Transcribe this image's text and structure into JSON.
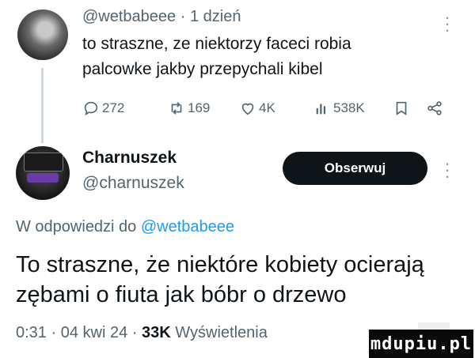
{
  "parent_tweet": {
    "handle": "@wetbabeee",
    "separator": "·",
    "time": "1 dzień",
    "text": "to straszne, ze niektorzy faceci robia palcowke jakby przepychali kibel",
    "actions": {
      "replies": "272",
      "retweets": "169",
      "likes": "4K",
      "views": "538K"
    }
  },
  "reply_tweet": {
    "display_name": "Charnuszek",
    "handle": "@charnuszek",
    "follow_label": "Obserwuj",
    "reply_to_prefix": "W odpowiedzi do",
    "reply_to_handle": "@wetbabeee",
    "text": "To straszne, że niektóre kobiety ocierają zębami o fiuta jak bóbr o drzewo",
    "time": "0:31",
    "separator": "·",
    "date": "04 kwi 24",
    "separator2": "·",
    "views_count": "33K",
    "views_label": "Wyświetlenia"
  },
  "watermark": "mdupiu.pl",
  "colors": {
    "text": "#0f1419",
    "secondary": "#536471",
    "link": "#1d9bf0",
    "button_bg": "#0f1419"
  }
}
